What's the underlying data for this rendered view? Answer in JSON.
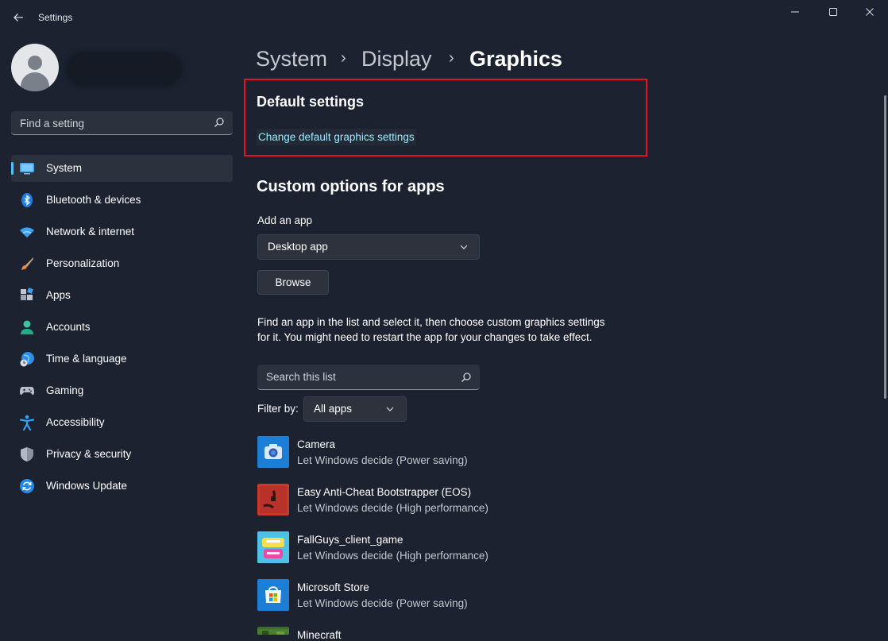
{
  "window": {
    "title": "Settings",
    "back_icon": "arrow-left-icon",
    "controls": [
      "minimize-icon",
      "maximize-icon",
      "close-icon"
    ]
  },
  "sidebar": {
    "search_placeholder": "Find a setting",
    "items": [
      {
        "label": "System",
        "icon": "display-icon",
        "active": true
      },
      {
        "label": "Bluetooth & devices",
        "icon": "bluetooth-icon"
      },
      {
        "label": "Network & internet",
        "icon": "wifi-icon"
      },
      {
        "label": "Personalization",
        "icon": "paintbrush-icon"
      },
      {
        "label": "Apps",
        "icon": "apps-icon"
      },
      {
        "label": "Accounts",
        "icon": "person-icon"
      },
      {
        "label": "Time & language",
        "icon": "globe-clock-icon"
      },
      {
        "label": "Gaming",
        "icon": "gamepad-icon"
      },
      {
        "label": "Accessibility",
        "icon": "accessibility-icon"
      },
      {
        "label": "Privacy & security",
        "icon": "shield-icon"
      },
      {
        "label": "Windows Update",
        "icon": "update-icon"
      }
    ]
  },
  "breadcrumb": {
    "items": [
      "System",
      "Display",
      "Graphics"
    ],
    "separator": "›"
  },
  "default_settings": {
    "heading": "Default settings",
    "link": "Change default graphics settings"
  },
  "custom": {
    "heading": "Custom options for apps",
    "add_label": "Add an app",
    "app_type": "Desktop app",
    "browse": "Browse",
    "description": "Find an app in the list and select it, then choose custom graphics settings for it. You might need to restart the app for your changes to take effect.",
    "search_placeholder": "Search this list",
    "filter_label": "Filter by:",
    "filter_value": "All apps"
  },
  "apps": [
    {
      "name": "Camera",
      "sub": "Let Windows decide (Power saving)",
      "icon": "camera-icon"
    },
    {
      "name": "Easy Anti-Cheat Bootstrapper (EOS)",
      "sub": "Let Windows decide (High performance)",
      "icon": "rust-game-icon"
    },
    {
      "name": "FallGuys_client_game",
      "sub": "Let Windows decide (High performance)",
      "icon": "fall-guys-icon"
    },
    {
      "name": "Microsoft Store",
      "sub": "Let Windows decide (Power saving)",
      "icon": "store-icon"
    },
    {
      "name": "Minecraft",
      "sub": "",
      "icon": "minecraft-icon"
    }
  ],
  "colors": {
    "background": "#1c2230",
    "accent": "#4cc2ff",
    "link": "#99ebff",
    "highlight_border": "#e81123"
  }
}
